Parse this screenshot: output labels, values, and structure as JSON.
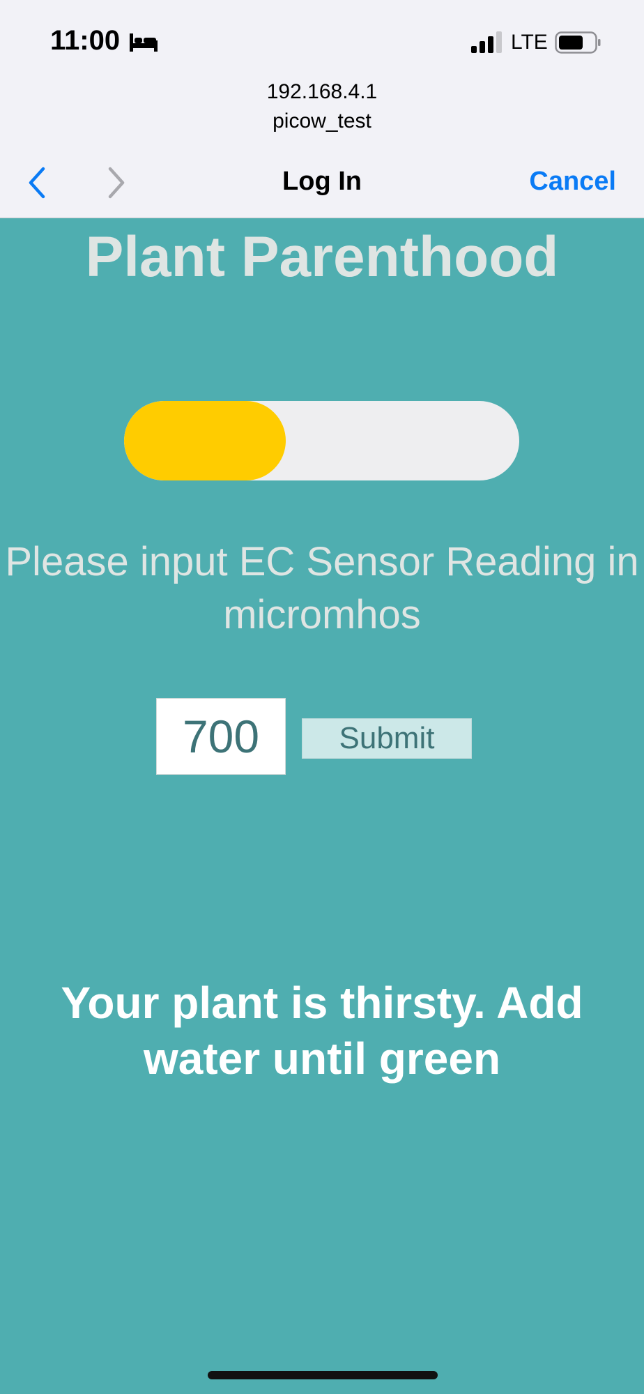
{
  "status_bar": {
    "time": "11:00",
    "network": "LTE",
    "icons": [
      "bed-icon",
      "signal-bars-icon",
      "battery-icon"
    ]
  },
  "browser": {
    "host": "192.168.4.1",
    "ssid": "picow_test",
    "title": "Log In",
    "cancel_label": "Cancel",
    "back_icon": "chevron-left-icon",
    "forward_icon": "chevron-right-icon"
  },
  "page": {
    "title": "Plant Parenthood",
    "moisture_level_fraction": 0.41,
    "prompt": "Please input EC Sensor Reading in micromhos",
    "input_value": "700",
    "submit_label": "Submit",
    "message": "Your plant is thirsty. Add water until green"
  },
  "colors": {
    "background": "#4faeb0",
    "progress_fill": "#ffcc00",
    "progress_track": "#eeeef0",
    "link_blue": "#0a7bf5"
  }
}
